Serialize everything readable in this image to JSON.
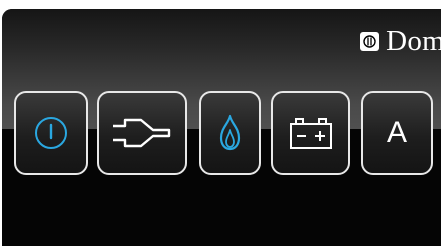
{
  "brand": {
    "text": "Dom",
    "logo_icon": "dometic-logo-badge"
  },
  "buttons": [
    {
      "name": "power-button",
      "icon": "power-icon",
      "icon_color": "#2aa7e0"
    },
    {
      "name": "electric-mode-button",
      "icon": "plug-icon",
      "icon_color": "#ffffff"
    },
    {
      "name": "gas-mode-button",
      "icon": "flame-icon",
      "icon_color": "#2aa7e0"
    },
    {
      "name": "battery-mode-button",
      "icon": "battery-icon",
      "icon_color": "#ffffff"
    },
    {
      "name": "auto-mode-button",
      "label": "A"
    }
  ],
  "colors": {
    "accent": "#2aa7e0",
    "button_border": "#e8e8e8",
    "panel_background": "#000000"
  }
}
